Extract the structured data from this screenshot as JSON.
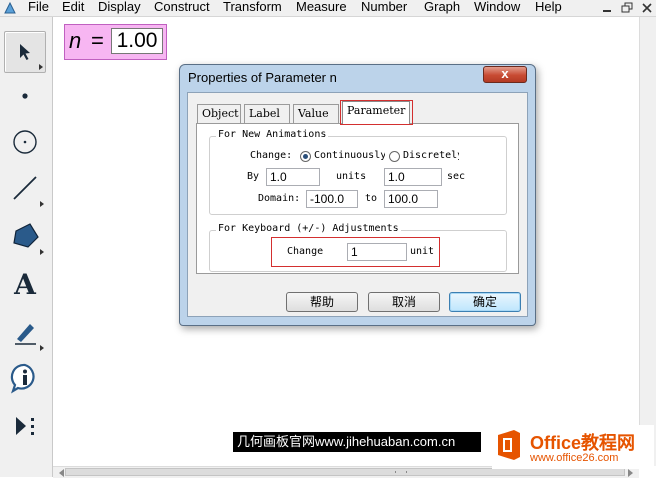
{
  "menubar": {
    "items": [
      "File",
      "Edit",
      "Display",
      "Construct",
      "Transform",
      "Measure",
      "Number",
      "Graph",
      "Window",
      "Help"
    ]
  },
  "toolbox": {
    "tools": [
      "arrow-tool",
      "point-tool",
      "compass-tool",
      "straightedge-tool",
      "polygon-tool",
      "text-tool",
      "marker-tool",
      "information-tool",
      "custom-tool"
    ],
    "text_tool_glyph": "A"
  },
  "canvas": {
    "parameter": {
      "name": "n",
      "equals": "=",
      "value": "1.00"
    }
  },
  "dialog": {
    "title": "Properties of Parameter n",
    "close_glyph": "x",
    "tabs": [
      "Object",
      "Label",
      "Value",
      "Parameter"
    ],
    "active_tab": "Parameter",
    "animations": {
      "group_title": "For New Animations",
      "change_label": "Change:",
      "continuous_label": "Continuously",
      "discrete_label": "Discretely",
      "selected": "continuous",
      "by_label": "By",
      "by_value": "1.0",
      "units_label": "units",
      "sec_value": "1.0",
      "sec_label": "sec",
      "domain_label": "Domain:",
      "domain_min": "-100.0",
      "to_label": "to",
      "domain_max": "100.0"
    },
    "keyboard": {
      "group_title": "For Keyboard (+/-) Adjustments",
      "change_label": "Change",
      "change_value": "1",
      "unit_label": "unit"
    },
    "buttons": {
      "help": "帮助",
      "cancel": "取消",
      "ok": "确定"
    }
  },
  "watermarks": {
    "left_text_cn": "几何画板官网",
    "left_text_url": "www.jihehuaban.com.cn",
    "right_title": "Office教程网",
    "right_url": "www.office26.com"
  },
  "colors": {
    "parameter_bg": "#f7b6f2",
    "dialog_frame": "#bcd3ea",
    "highlight": "#d32f2f",
    "office_orange": "#e65400"
  }
}
